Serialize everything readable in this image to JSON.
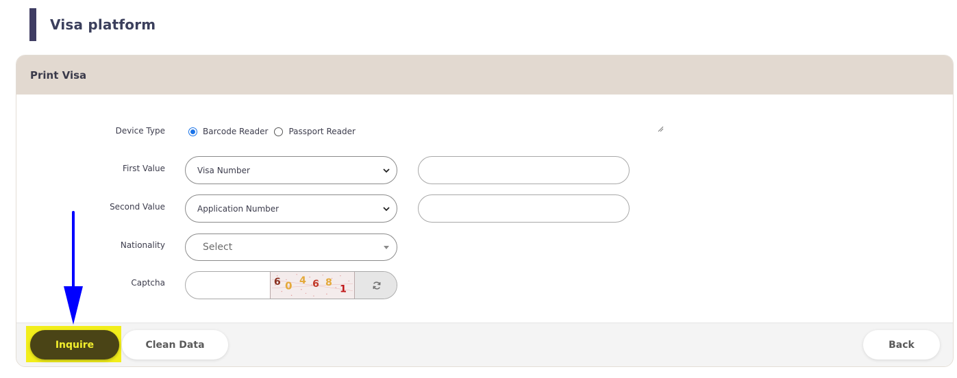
{
  "page": {
    "title": "Visa platform"
  },
  "card": {
    "title": "Print Visa"
  },
  "form": {
    "device_type": {
      "label": "Device Type",
      "options": [
        "Barcode Reader",
        "Passport Reader"
      ],
      "selected": "Barcode Reader"
    },
    "first_value": {
      "label": "First Value",
      "selected": "Visa Number",
      "input_value": ""
    },
    "second_value": {
      "label": "Second Value",
      "selected": "Application Number",
      "input_value": ""
    },
    "nationality": {
      "label": "Nationality",
      "placeholder": "Select"
    },
    "captcha": {
      "label": "Captcha",
      "input_value": "",
      "image_text": "604681"
    }
  },
  "buttons": {
    "inquire": "Inquire",
    "clean": "Clean Data",
    "back": "Back"
  },
  "colors": {
    "header_bar": "#3f3d63",
    "card_header_bg": "#e2d9d0",
    "inquire_bg": "#4a4416",
    "inquire_text": "#f3ef2d",
    "highlight": "#f2ee1b",
    "annotation_arrow": "#0000ff",
    "radio_checked": "#1a73e8"
  },
  "icons": {
    "select_chevron": "chevron-down-icon",
    "captcha_refresh": "refresh-icon",
    "annotation": "arrow-down-icon"
  }
}
